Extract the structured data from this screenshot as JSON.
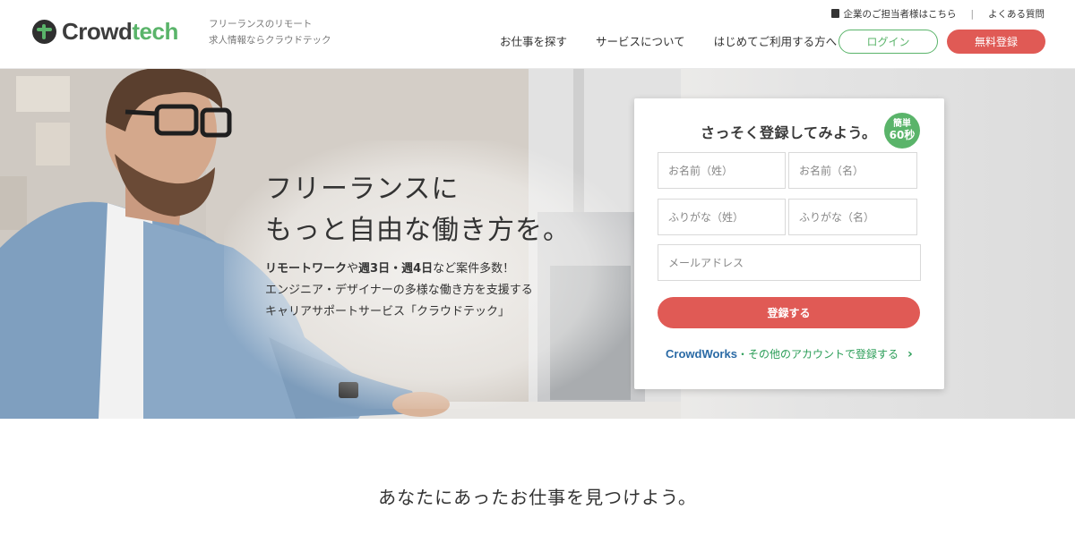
{
  "brand": {
    "logo_text_dark": "Crowd",
    "logo_text_green": "tech",
    "tagline_line1": "フリーランスのリモート",
    "tagline_line2": "求人情報ならクラウドテック"
  },
  "top_links": {
    "corporate": "企業のご担当者様はこちら",
    "separator": "|",
    "faq": "よくある質問"
  },
  "nav": {
    "items": [
      "お仕事を探す",
      "サービスについて",
      "はじめてご利用する方へ"
    ],
    "login": "ログイン",
    "signup": "無料登録"
  },
  "hero": {
    "title_line1": "フリーランスに",
    "title_line2": "もっと自由な働き方を。",
    "body_bold1": "リモートワーク",
    "body_text1": "や",
    "body_bold2": "週3日・週4日",
    "body_text2": "など案件多数！",
    "body_line2": "エンジニア・デザイナーの多様な働き方を支援する",
    "body_line3": "キャリアサポートサービス「クラウドテック」"
  },
  "form": {
    "title": "さっそく登録してみよう。",
    "badge_line1": "簡単",
    "badge_line2": "60秒",
    "last_name_placeholder": "お名前（姓）",
    "first_name_placeholder": "お名前（名）",
    "last_kana_placeholder": "ふりがな（姓）",
    "first_kana_placeholder": "ふりがな（名）",
    "email_placeholder": "メールアドレス",
    "submit": "登録する",
    "cw_brand": "CrowdWorks",
    "cw_text": "・その他のアカウントで登録する",
    "cw_chevron": "›"
  },
  "section": {
    "title": "あなたにあったお仕事を見つけよう。"
  },
  "colors": {
    "brand_green": "#5ab46a",
    "accent_red": "#e05a55",
    "link_green": "#2a9d57",
    "cw_blue": "#2a6aa5"
  }
}
